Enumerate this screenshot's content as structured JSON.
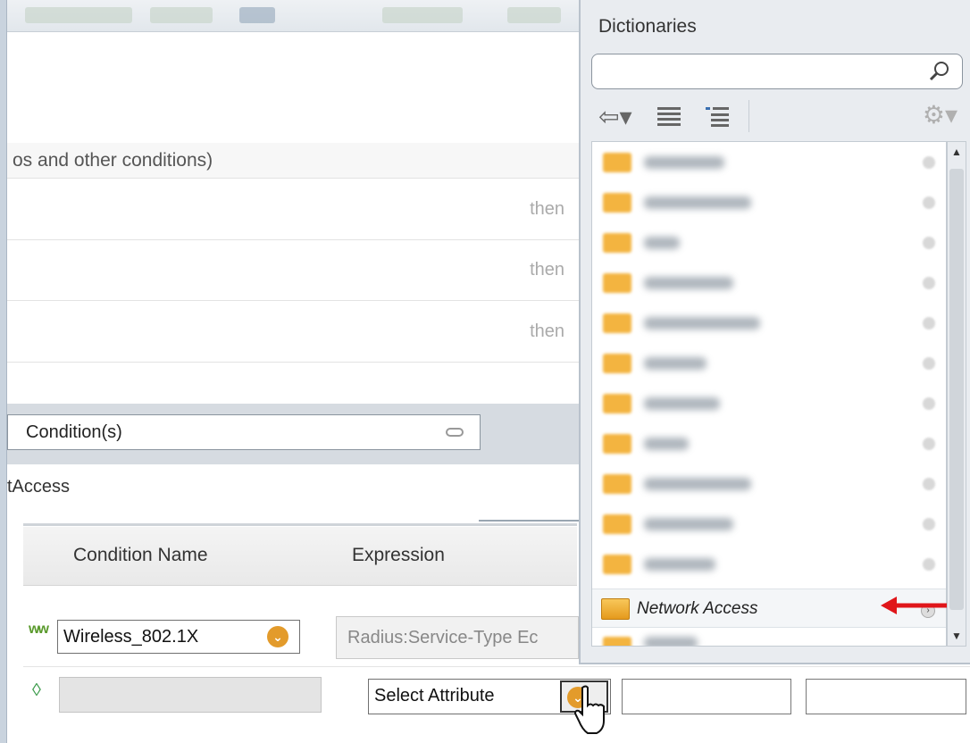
{
  "background": {
    "partial_text": "os and other conditions)",
    "then_labels": [
      "then",
      "then",
      "then"
    ],
    "condition_button_label": "Condition(s)",
    "partial_text_2": "tAccess"
  },
  "conditions_table": {
    "headers": {
      "condition_name": "Condition Name",
      "expression": "Expression"
    },
    "row1": {
      "condition_name_value": "Wireless_802.1X",
      "expression_value": "Radius:Service-Type Ec"
    },
    "row2": {
      "attribute_select": "Select Attribute"
    }
  },
  "dictionaries_panel": {
    "title": "Dictionaries",
    "search": {
      "value": "",
      "placeholder": ""
    },
    "highlighted_item": "Network Access"
  },
  "colors": {
    "folder": "#f3b440",
    "dropdown_chevron": "#e39b2b",
    "annotation_arrow": "#e0161a"
  }
}
